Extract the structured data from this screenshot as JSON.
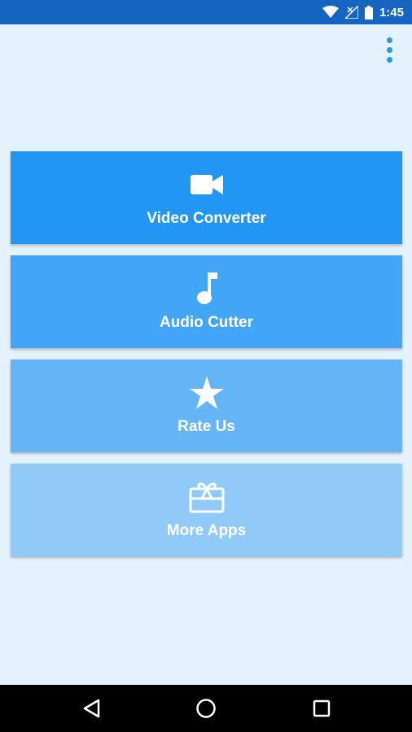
{
  "status_bar": {
    "time": "1:45",
    "icons": [
      "wifi-icon",
      "signal-icon",
      "battery-icon"
    ],
    "color": "#1565C0"
  },
  "app": {
    "background": "#E3F2FD",
    "menu_icon": "more-vert-icon"
  },
  "menu": {
    "items": [
      {
        "label": "Video Converter",
        "icon": "video-camera-icon",
        "color": "#2196F3"
      },
      {
        "label": "Audio Cutter",
        "icon": "music-note-icon",
        "color": "#42A5F5"
      },
      {
        "label": "Rate Us",
        "icon": "star-icon",
        "color": "#64B5F6"
      },
      {
        "label": "More Apps",
        "icon": "gift-card-icon",
        "color": "#90CAF9"
      }
    ]
  },
  "nav_bar": {
    "buttons": [
      "back-icon",
      "home-icon",
      "recents-icon"
    ]
  }
}
